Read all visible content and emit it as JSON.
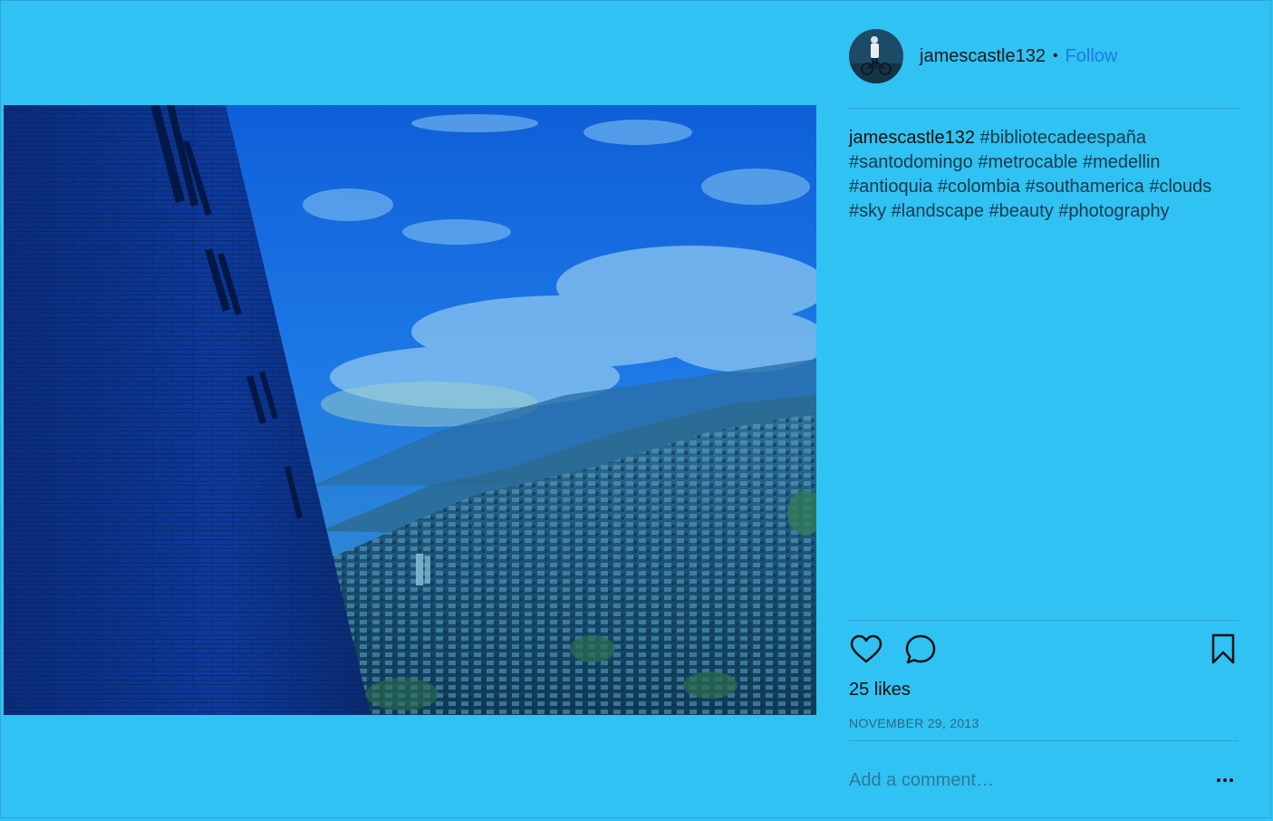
{
  "post": {
    "username": "jamescastle132",
    "separator": "•",
    "follow_label": "Follow",
    "caption_user": "jamescastle132",
    "caption_lines": [
      "#bibliotecadeespaña",
      "#santodomingo #metrocable #medellin",
      "#antioquia #colombia #southamerica #clouds",
      "#sky #landscape #beauty #photography"
    ],
    "likes_text": "25 likes",
    "date_text": "NOVEMBER 29, 2013",
    "comment_placeholder": "Add a comment…"
  },
  "icons": {
    "like": "heart-icon",
    "comment": "comment-bubble-icon",
    "save": "bookmark-icon",
    "more": "more-options-icon"
  },
  "colors": {
    "background": "#30c2f2",
    "follow": "#1f7ae6",
    "divider": "#2aa3d2"
  }
}
